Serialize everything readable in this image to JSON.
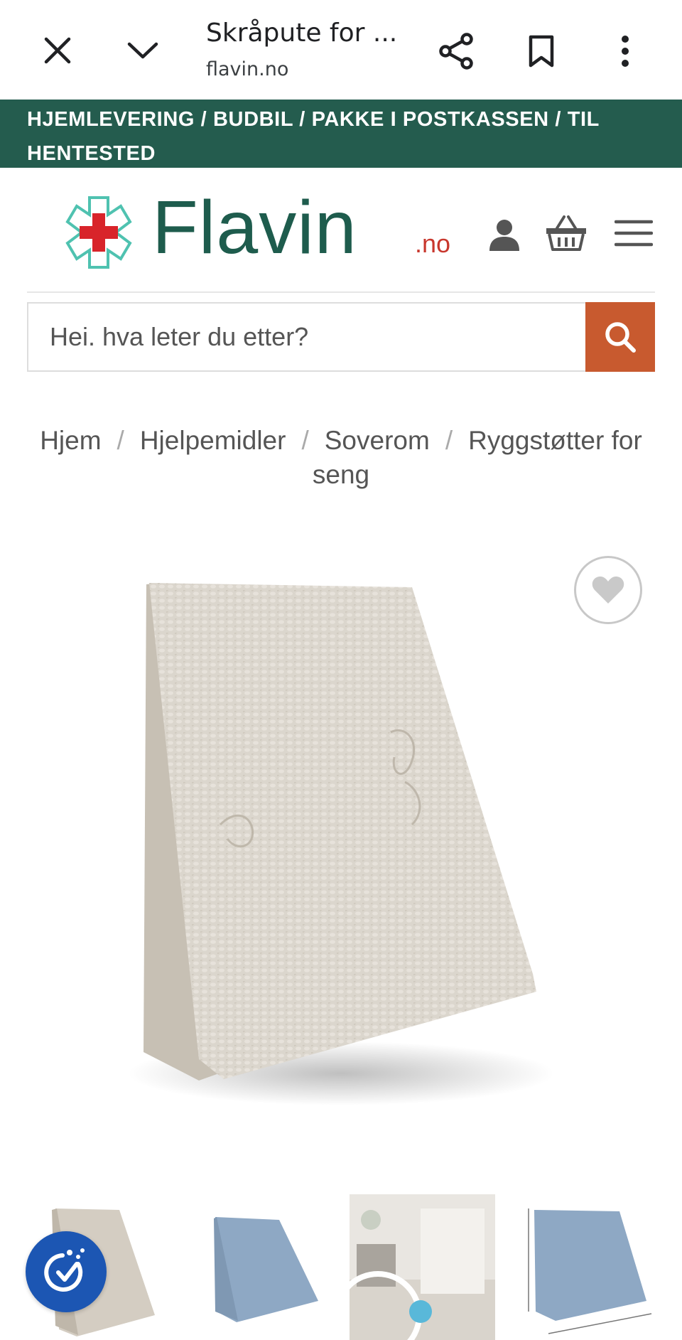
{
  "browser": {
    "title": "Skråpute for ...",
    "url": "flavin.no"
  },
  "banner": {
    "text": "HJEMLEVERING / BUDBIL / PAKKE I POSTKASSEN / TIL HENTESTED"
  },
  "logo": {
    "name": "Flavin",
    "tld": ".no"
  },
  "search": {
    "placeholder": "Hei. hva leter du etter?"
  },
  "breadcrumb": {
    "items": [
      "Hjem",
      "Hjelpemidler",
      "Soverom",
      "Ryggstøtter for seng"
    ]
  },
  "colors": {
    "banner_bg": "#245c4e",
    "brand_green": "#1e5c4d",
    "brand_red": "#c8372d",
    "search_button": "#c85a2f",
    "a11y_badge": "#1c56b3"
  },
  "icons": {
    "close": "close-icon",
    "chevron": "chevron-down-icon",
    "share": "share-icon",
    "bookmark": "bookmark-icon",
    "more": "more-vert-icon",
    "account": "user-icon",
    "cart": "basket-icon",
    "menu": "hamburger-icon",
    "search": "search-icon",
    "wishlist": "heart-icon",
    "accessibility": "accessibility-icon"
  }
}
